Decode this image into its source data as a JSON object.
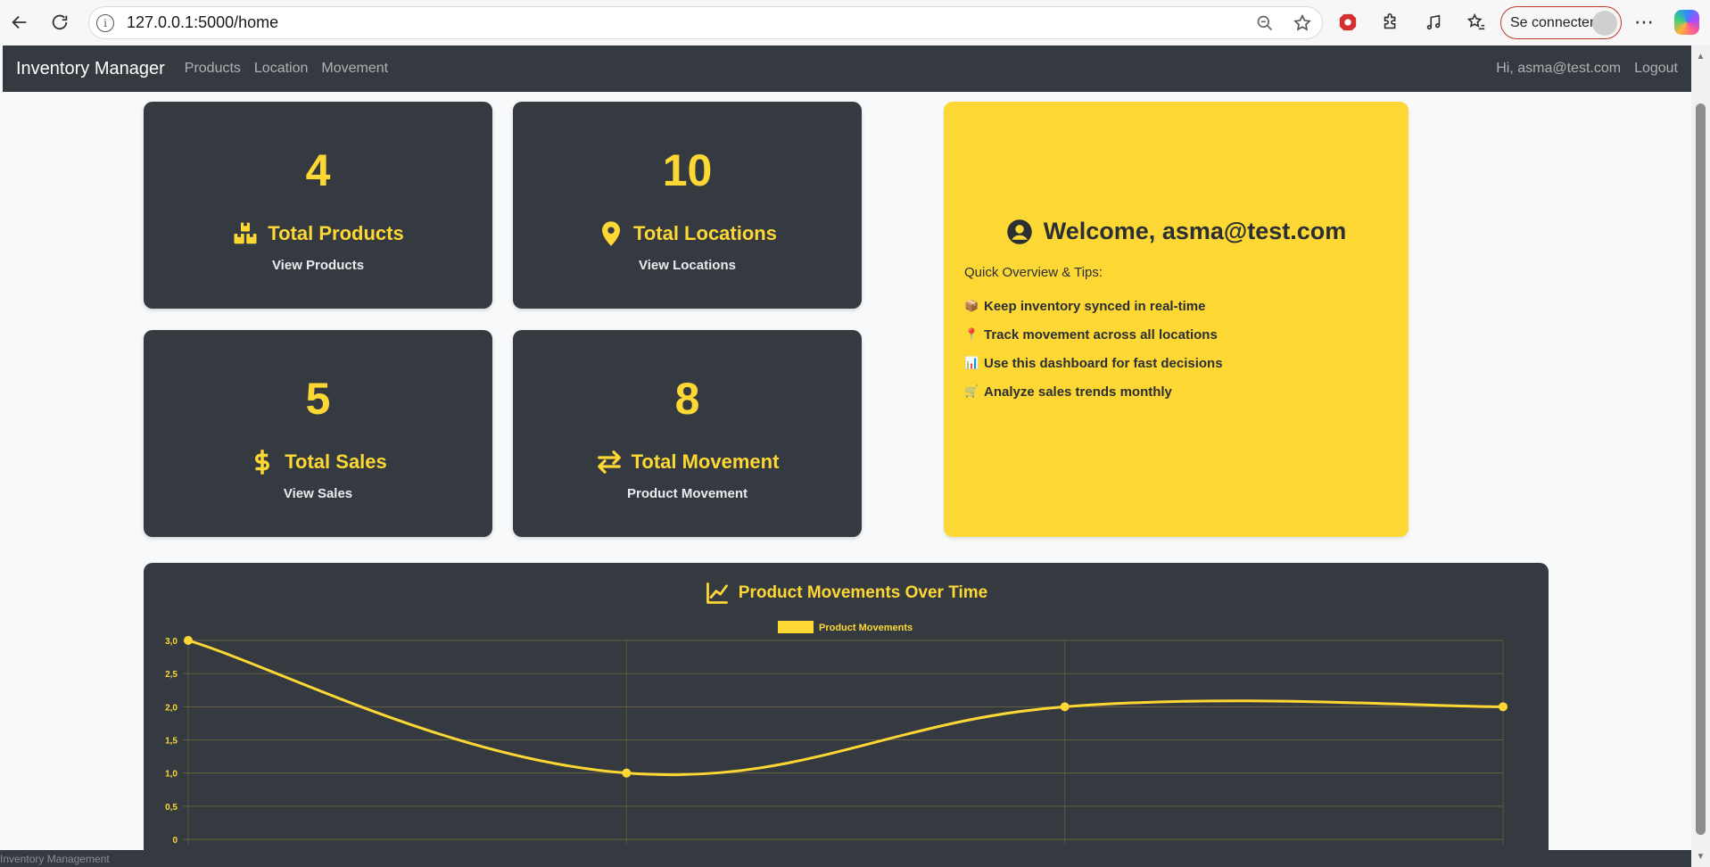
{
  "browser": {
    "url": "127.0.0.1:5000/home",
    "signin_label": "Se connecter",
    "more_label": "⋯"
  },
  "navbar": {
    "brand": "Inventory Manager",
    "links": [
      "Products",
      "Location",
      "Movement"
    ],
    "greeting": "Hi, asma@test.com",
    "logout": "Logout"
  },
  "cards": [
    {
      "value": "4",
      "title": "Total Products",
      "link": "View Products",
      "icon": "boxes-icon"
    },
    {
      "value": "10",
      "title": "Total Locations",
      "link": "View Locations",
      "icon": "map-pin-icon"
    },
    {
      "value": "5",
      "title": "Total Sales",
      "link": "View Sales",
      "icon": "dollar-icon"
    },
    {
      "value": "8",
      "title": "Total Movement",
      "link": "Product Movement",
      "icon": "arrows-exchange-icon"
    }
  ],
  "welcome": {
    "title": "Welcome, asma@test.com",
    "subtitle": "Quick Overview & Tips:",
    "tips": [
      {
        "icon": "📦",
        "text": "Keep inventory synced in real-time"
      },
      {
        "icon": "📍",
        "text": "Track movement across all locations"
      },
      {
        "icon": "📊",
        "text": "Use this dashboard for fast decisions"
      },
      {
        "icon": "🛒",
        "text": "Analyze sales trends monthly"
      }
    ]
  },
  "chart_section": {
    "title": "Product Movements Over Time"
  },
  "chart_data": {
    "type": "line",
    "series": [
      {
        "name": "Product Movements",
        "values": [
          3,
          1,
          2,
          2
        ]
      }
    ],
    "ylim": [
      0,
      3
    ],
    "y_ticks": [
      "0",
      "0,5",
      "1,0",
      "1,5",
      "2,0",
      "2,5",
      "3,0"
    ],
    "legend": "top",
    "grid": true,
    "color": "#fdd835"
  },
  "footer": {
    "text": "Inventory Management"
  },
  "colors": {
    "accent": "#fdd835",
    "dark": "#343a40"
  }
}
